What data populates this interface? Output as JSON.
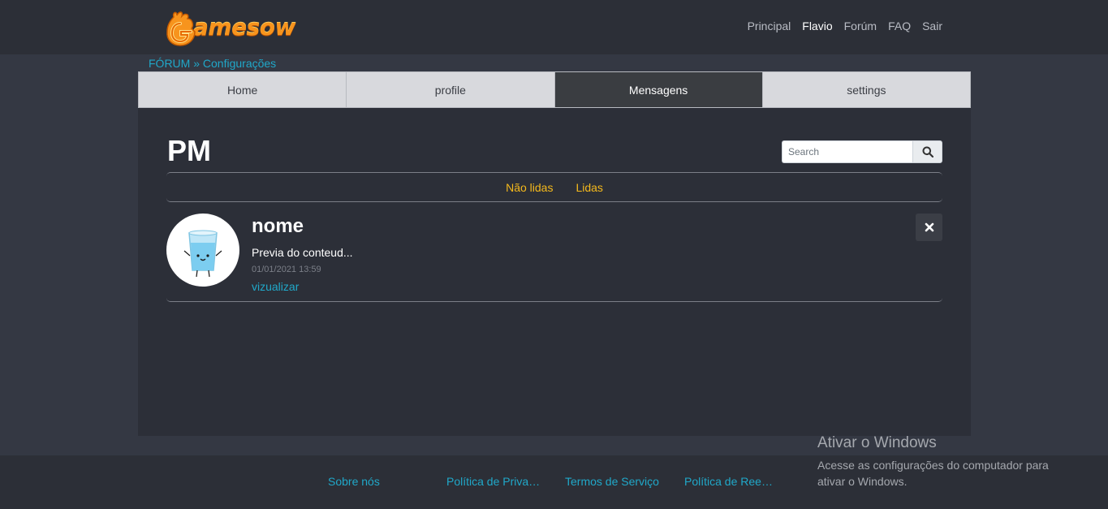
{
  "header": {
    "logo_text": "Gamesow",
    "nav": [
      {
        "label": "Principal",
        "active": false
      },
      {
        "label": "Flavio",
        "active": true
      },
      {
        "label": "Forúm",
        "active": false
      },
      {
        "label": "FAQ",
        "active": false
      },
      {
        "label": "Sair",
        "active": false
      }
    ]
  },
  "breadcrumb": {
    "root": "FÓRUM",
    "separator": "»",
    "current": "Configurações"
  },
  "tabs": [
    {
      "label": "Home",
      "active": false
    },
    {
      "label": "profile",
      "active": false
    },
    {
      "label": "Mensagens",
      "active": true
    },
    {
      "label": "settings",
      "active": false
    }
  ],
  "main": {
    "title": "PM",
    "search": {
      "placeholder": "Search",
      "value": "",
      "icon": "search-icon"
    },
    "filters": [
      {
        "label": "Não lidas"
      },
      {
        "label": "Lidas"
      }
    ],
    "messages": [
      {
        "name": "nome",
        "preview": "Previa do conteud...",
        "date": "01/01/2021 13:59",
        "view_label": "vizualizar",
        "avatar_icon": "water-glass-mascot-icon",
        "close_icon": "close-icon"
      }
    ]
  },
  "footer": {
    "links": [
      {
        "label": "Sobre nós"
      },
      {
        "label": "Política de Privacidade"
      },
      {
        "label": "Termos de Serviço"
      },
      {
        "label": "Política de Reembolso"
      }
    ]
  },
  "watermark": {
    "title": "Ativar o Windows",
    "subtitle": "Acesse as configurações do computador para ativar o Windows."
  },
  "colors": {
    "background": "#343843",
    "header": "#2c2f37",
    "panel": "#2c2f38",
    "link": "#20a8c9",
    "filter": "#f5b91c",
    "tab_active": "#3a3d41",
    "tab_inactive": "#d8d9dd",
    "logo": "#f7941d"
  }
}
